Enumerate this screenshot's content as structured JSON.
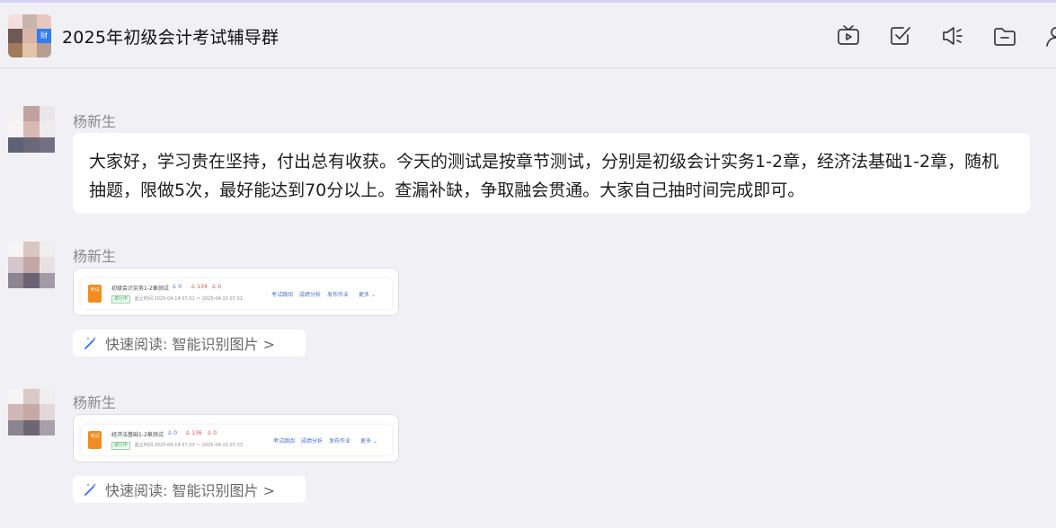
{
  "header": {
    "group_title": "2025年初级会计考试辅导群",
    "group_avatar_badge": "财",
    "tools": [
      "tv-icon",
      "checkbox-icon",
      "speaker-icon",
      "folder-icon",
      "person-icon"
    ]
  },
  "messages": [
    {
      "sender": "杨新生",
      "text": "大家好，学习贵在坚持，付出总有收获。今天的测试是按章节测试，分别是初级会计实务1-2章，经济法基础1-2章，随机抽题，限做5次，最好能达到70分以上。查漏补缺，争取融会贯通。大家自己抽时间完成即可。"
    },
    {
      "sender": "杨新生",
      "card": {
        "icon_text": "考试",
        "title": "初级会计实务1-2章测试",
        "stat_a": "0",
        "stat_b": "134",
        "stat_c": "0",
        "status": "进行中",
        "time": "起止时间 2025-04-14 07:31 ～ 2025-04-15 07:31",
        "links": [
          "考试跳阅",
          "成绩分析",
          "发布作业"
        ],
        "more": "更多"
      },
      "quickread": "快速阅读: 智能识别图片 >"
    },
    {
      "sender": "杨新生",
      "card": {
        "icon_text": "考试",
        "title": "经济法基础1-2章测试",
        "stat_a": "0",
        "stat_b": "136",
        "stat_c": "0",
        "status": "进行中",
        "time": "起止时间 2025-04-14 07:33 ～ 2025-04-15 07:33",
        "links": [
          "考试跳阅",
          "成绩分析",
          "发布作业"
        ],
        "more": "更多"
      },
      "quickread": "快速阅读: 智能识别图片 >"
    }
  ],
  "colors": {
    "background": "#f1f0f5",
    "accent_link": "#4a73c9",
    "doc_icon": "#f28c1e",
    "status_green": "#3aa856",
    "stat_red": "#e04a4a",
    "stat_blue": "#4a73c9"
  }
}
